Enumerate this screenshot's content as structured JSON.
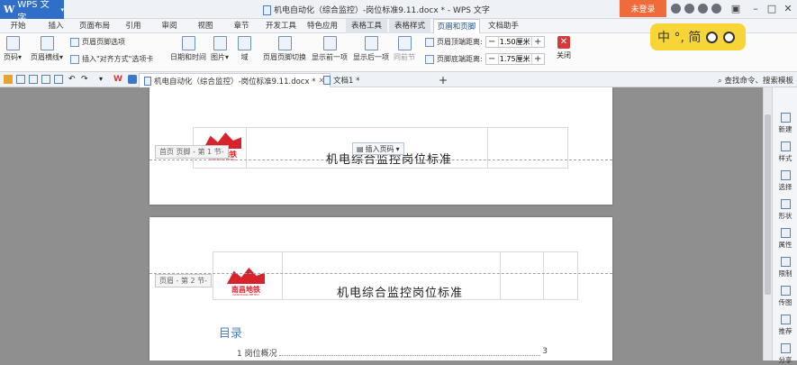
{
  "titlebar": {
    "app_name": "WPS 文字",
    "doc_title": "机电自动化（综合监控）-岗位标准9.11.docx * - WPS 文字",
    "login_label": "未登录"
  },
  "menu": [
    "开始",
    "插入",
    "页面布局",
    "引用",
    "审阅",
    "视图",
    "章节",
    "开发工具",
    "特色应用",
    "表格工具",
    "表格样式",
    "页眉和页脚",
    "文档助手"
  ],
  "ribbon": {
    "page_number": "页码",
    "header_line": "页眉横线",
    "header_footer_options": "页眉页脚选项",
    "insert_align_tab": "插入\"对齐方式\"选项卡",
    "date_time": "日期和时间",
    "picture": "图片",
    "field": "域",
    "switch_hf": "页眉页脚切换",
    "show_prev": "显示前一项",
    "show_next": "显示后一项",
    "same_as_prev": "同前节",
    "header_top_label": "页眉顶端距离:",
    "header_top_value": "1.50厘米",
    "footer_bottom_label": "页脚底端距离:",
    "footer_bottom_value": "1.75厘米",
    "close": "关闭"
  },
  "ime": {
    "text": "中 °, 简"
  },
  "tabs": [
    {
      "label": "机电自动化（综合监控）-岗位标准9.11.docx *"
    },
    {
      "label": "文档1 *"
    }
  ],
  "search_cmd": "查找命令、搜索模板",
  "page1": {
    "header_tag": "首页 页脚 - 第 1 节-",
    "title": "机电综合监控岗位标准",
    "insert_page_num": "插入页码"
  },
  "page2": {
    "header_tag": "页眉 - 第 2 节-",
    "title": "机电综合监控岗位标准",
    "toc_title": "目录",
    "toc_item": "1 岗位概况",
    "toc_page": "3"
  },
  "logo": {
    "cn": "南昌地铁",
    "en": "NANCHANG METRO"
  },
  "right_panel": [
    "新建",
    "样式",
    "选择",
    "形状",
    "属性",
    "限制",
    "传图",
    "推荐",
    "分享"
  ]
}
